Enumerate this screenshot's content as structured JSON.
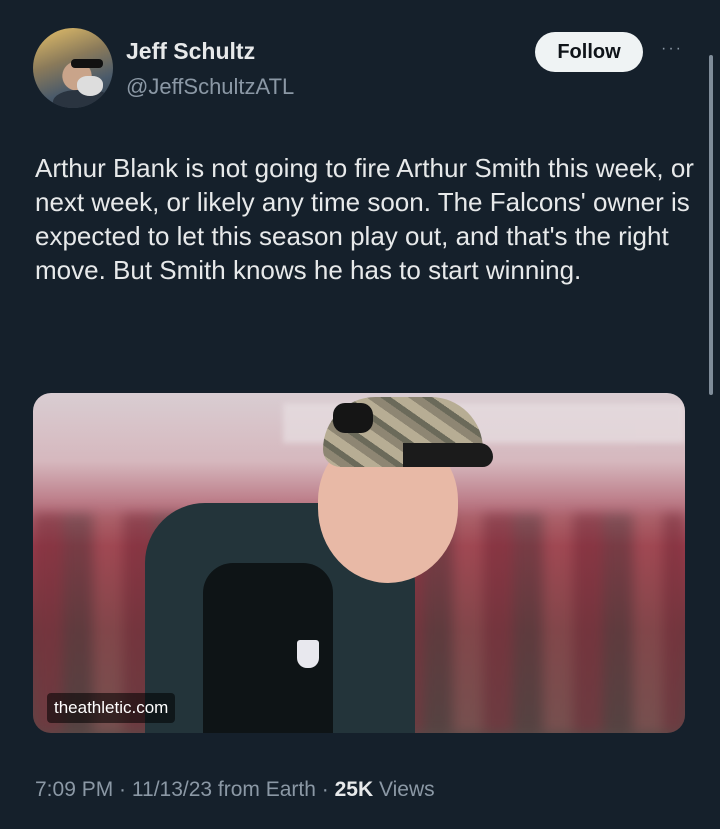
{
  "author": {
    "name": "Jeff Schultz",
    "handle": "@JeffSchultzATL"
  },
  "header": {
    "follow_label": "Follow",
    "more_icon": "···"
  },
  "tweet": {
    "text": "Arthur Blank is not going to fire Arthur Smith this week, or next week, or likely any time soon. The Falcons' owner is expected to let this season play out, and that's the right move. But Smith knows he has to start winning."
  },
  "media": {
    "source_label": "theathletic.com"
  },
  "meta": {
    "time": "7:09 PM",
    "sep1": " · ",
    "date": "11/13/23",
    "via": " from Earth",
    "sep2": " · ",
    "views_count": "25K",
    "views_label": " Views"
  },
  "colors": {
    "background": "#15202b",
    "text_primary": "#e7e9ea",
    "text_secondary": "#8b98a5",
    "follow_button_bg": "#eff3f4"
  },
  "icons": {
    "more": "more-horizontal-icon"
  }
}
